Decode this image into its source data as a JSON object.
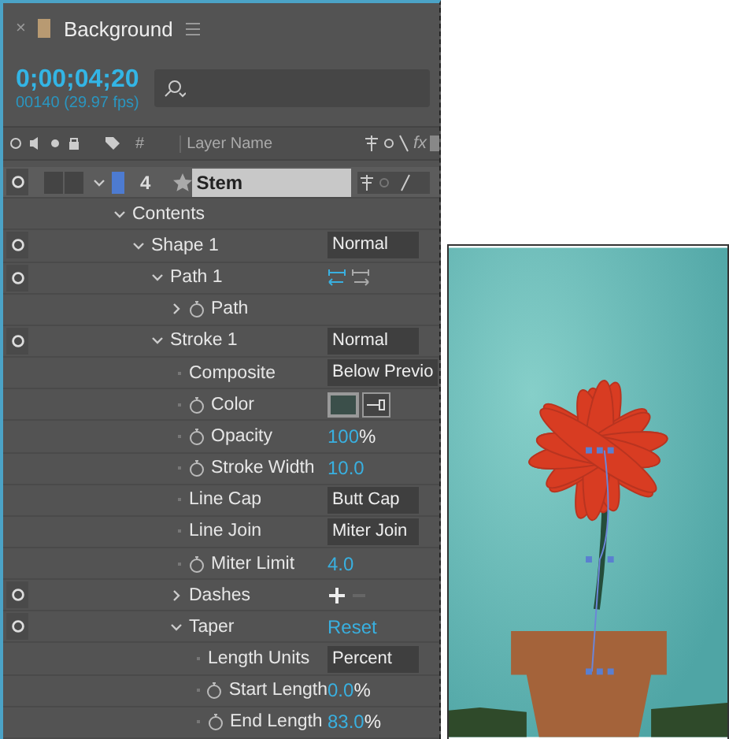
{
  "panel": {
    "close": "×",
    "title": "Background",
    "timecode": "0;00;04;20",
    "frame_info": "00140 (29.97 fps)"
  },
  "columns": {
    "number": "#",
    "layer_name": "Layer Name",
    "effects": "fx"
  },
  "layer": {
    "number": "4",
    "name": "Stem",
    "expanded": true,
    "selected": true,
    "audio": false,
    "locked": false,
    "children": [
      {
        "label": "Contents",
        "eye": false,
        "stopwatch": false,
        "expanded": true,
        "children": [
          {
            "label": "Shape 1",
            "eye": true,
            "stopwatch": false,
            "expanded": true,
            "value": {
              "kind": "dropdown",
              "text": "Normal"
            },
            "children": [
              {
                "label": "Path 1",
                "eye": true,
                "stopwatch": false,
                "expanded": true,
                "value": {
                  "kind": "path_ops"
                },
                "children": [
                  {
                    "label": "Path",
                    "eye": false,
                    "expanded": false,
                    "stopwatch": true
                  }
                ]
              },
              {
                "label": "Stroke 1",
                "eye": true,
                "stopwatch": false,
                "expanded": true,
                "value": {
                  "kind": "dropdown",
                  "text": "Normal"
                },
                "children": [
                  {
                    "label": "Composite",
                    "eye": false,
                    "stopwatch": false,
                    "value": {
                      "kind": "dropdown",
                      "text": "Below Previo"
                    }
                  },
                  {
                    "label": "Color",
                    "eye": false,
                    "stopwatch": true,
                    "value": {
                      "kind": "color",
                      "color": "#3b4f4a"
                    }
                  },
                  {
                    "label": "Opacity",
                    "eye": false,
                    "stopwatch": true,
                    "value": {
                      "kind": "number",
                      "text": "100",
                      "unit": "%"
                    }
                  },
                  {
                    "label": "Stroke Width",
                    "eye": false,
                    "stopwatch": true,
                    "value": {
                      "kind": "number",
                      "text": "10.0"
                    }
                  },
                  {
                    "label": "Line Cap",
                    "eye": false,
                    "stopwatch": false,
                    "value": {
                      "kind": "dropdown",
                      "text": "Butt Cap"
                    }
                  },
                  {
                    "label": "Line Join",
                    "eye": false,
                    "stopwatch": false,
                    "value": {
                      "kind": "dropdown",
                      "text": "Miter Join"
                    }
                  },
                  {
                    "label": "Miter Limit",
                    "eye": false,
                    "stopwatch": true,
                    "value": {
                      "kind": "number",
                      "text": "4.0"
                    }
                  },
                  {
                    "label": "Dashes",
                    "eye": true,
                    "stopwatch": false,
                    "expanded": false,
                    "value": {
                      "kind": "dashes"
                    }
                  },
                  {
                    "label": "Taper",
                    "eye": true,
                    "stopwatch": false,
                    "expanded": true,
                    "value": {
                      "kind": "link",
                      "text": "Reset"
                    },
                    "children": [
                      {
                        "label": "Length Units",
                        "eye": false,
                        "stopwatch": false,
                        "value": {
                          "kind": "dropdown",
                          "text": "Percent"
                        }
                      },
                      {
                        "label": "Start Length",
                        "eye": false,
                        "stopwatch": true,
                        "value": {
                          "kind": "number",
                          "text": "0.0",
                          "unit": "%"
                        }
                      },
                      {
                        "label": "End Length",
                        "eye": false,
                        "stopwatch": true,
                        "value": {
                          "kind": "number",
                          "text": "83.0",
                          "unit": "%"
                        }
                      }
                    ]
                  }
                ]
              }
            ]
          }
        ]
      }
    ]
  }
}
